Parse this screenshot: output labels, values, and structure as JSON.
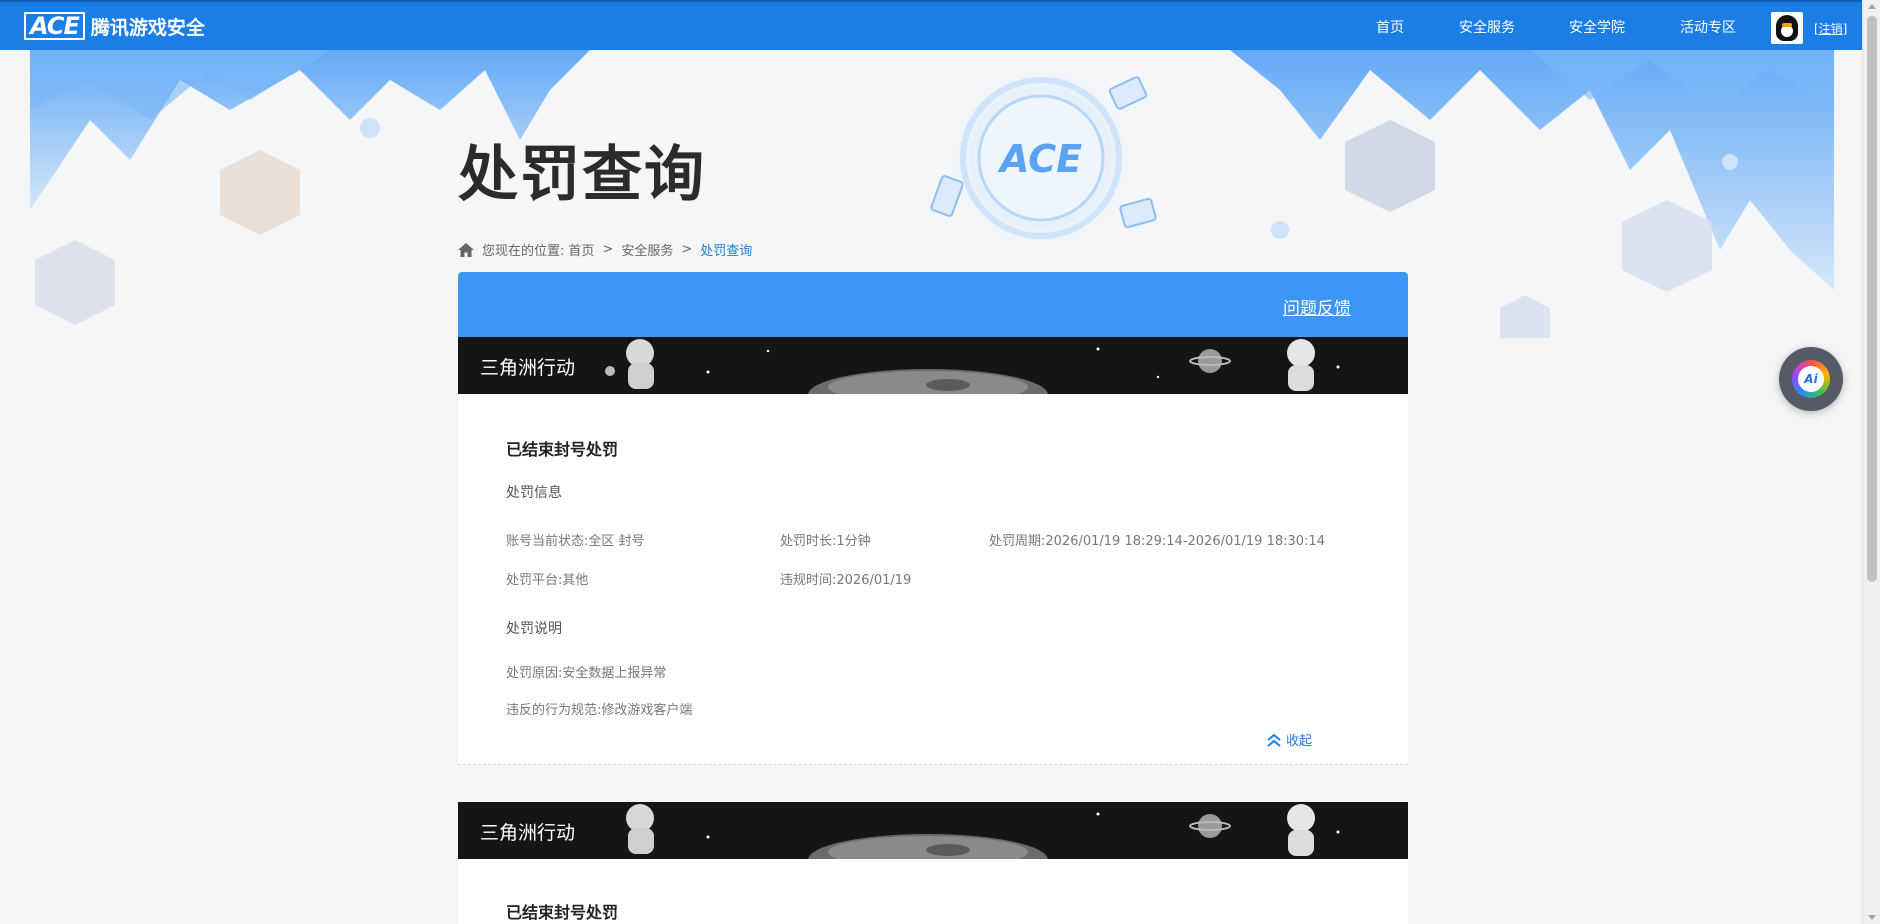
{
  "header": {
    "logo_mark": "ACE",
    "logo_text": "腾讯游戏安全",
    "nav": [
      "首页",
      "安全服务",
      "安全学院",
      "活动专区"
    ],
    "logout": "[注销]"
  },
  "hero": {
    "title": "处罚查询",
    "breadcrumb": {
      "prefix": "您现在的位置:",
      "items": [
        "首页",
        "安全服务",
        "处罚查询"
      ],
      "separator": ">"
    },
    "emblem_text": "ACE"
  },
  "panel": {
    "feedback_link": "问题反馈",
    "records": [
      {
        "game": "三角洲行动",
        "title": "已结束封号处罚",
        "info_heading": "处罚信息",
        "status": "账号当前状态:全区 封号",
        "duration": "处罚时长:1分钟",
        "period": "处罚周期:2026/01/19 18:29:14-2026/01/19 18:30:14",
        "platform": "处罚平台:其他",
        "violation_time": "违规时间:2026/01/19",
        "desc_heading": "处罚说明",
        "reason": "处罚原因:安全数据上报异常",
        "rule": "违反的行为规范:修改游戏客户端",
        "collapse": "收起"
      },
      {
        "game": "三角洲行动",
        "title": "已结束封号处罚"
      }
    ]
  },
  "widgets": {
    "ai_label": "Ai"
  },
  "colors": {
    "nav_blue": "#1a7ee6",
    "panel_blue": "#3b97f6",
    "link_blue": "#1a7ee6"
  }
}
